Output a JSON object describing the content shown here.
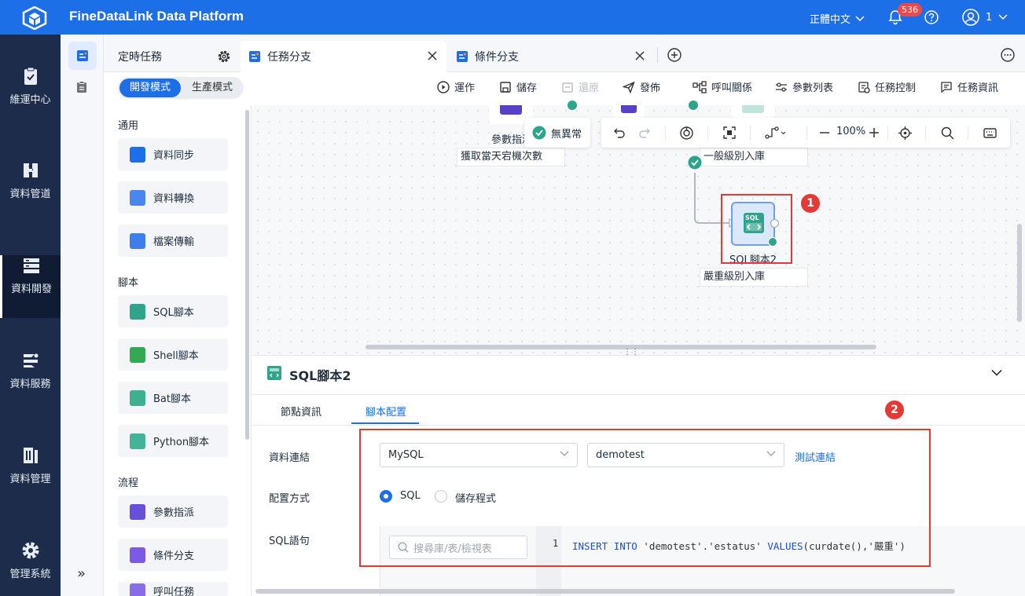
{
  "app": {
    "title": "FineDataLink Data Platform",
    "language": "正體中文",
    "notification_count": "536",
    "user": "1"
  },
  "nav": {
    "items": [
      {
        "label": "維運中心",
        "icon": "clipboard-check-icon"
      },
      {
        "label": "資料管道",
        "icon": "pipeline-icon"
      },
      {
        "label": "資料開發",
        "icon": "server-stack-icon",
        "active": true
      },
      {
        "label": "資料服務",
        "icon": "service-icon"
      },
      {
        "label": "資料管理",
        "icon": "data-management-icon"
      },
      {
        "label": "管理系統",
        "icon": "gear-icon"
      }
    ]
  },
  "tabs": [
    {
      "label": "定時任務"
    },
    {
      "label": "任務分支",
      "active": true
    },
    {
      "label": "條件分支"
    }
  ],
  "mode": {
    "dev": "開發模式",
    "prod": "生產模式"
  },
  "toolbar": {
    "run": "運作",
    "save": "儲存",
    "restore": "還原",
    "publish": "發佈",
    "call_relation": "呼叫關係",
    "param_list": "參數列表",
    "task_control": "任務控制",
    "task_info": "任務資訊"
  },
  "components": {
    "sections": [
      {
        "title": "通用",
        "items": [
          "資料同步",
          "資料轉換",
          "檔案傳輸"
        ]
      },
      {
        "title": "腳本",
        "items": [
          "SQL腳本",
          "Shell腳本",
          "Bat腳本",
          "Python腳本"
        ]
      },
      {
        "title": "流程",
        "items": [
          "參數指派",
          "條件分支",
          "呼叫任務"
        ]
      }
    ]
  },
  "canvas": {
    "status": "無異常",
    "zoom": "100%",
    "node_param_name": "參數指派",
    "node_param_desc": "獲取當天宕機次數",
    "node_general_desc": "一般級別入庫",
    "node_sql_icon": "SQL",
    "node_sql_name": "SQL腳本2",
    "node_sql_desc": "嚴重級別入庫",
    "markers": [
      "1",
      "2"
    ]
  },
  "detail": {
    "title": "SQL腳本2",
    "tabs": [
      "節點資訊",
      "腳本配置"
    ],
    "active_tab": "腳本配置",
    "fields": {
      "connection_label": "資料連結",
      "connection_type": "MySQL",
      "connection_db": "demotest",
      "test_link": "測試連結",
      "config_label": "配置方式",
      "config_options": [
        "SQL",
        "儲存程式"
      ],
      "config_selected": "SQL",
      "sql_label": "SQL語句",
      "search_placeholder": "搜尋庫/表/檢視表",
      "line_number": "1",
      "code": "INSERT INTO 'demotest'.'estatus' VALUES(curdate(),'嚴重')"
    }
  }
}
